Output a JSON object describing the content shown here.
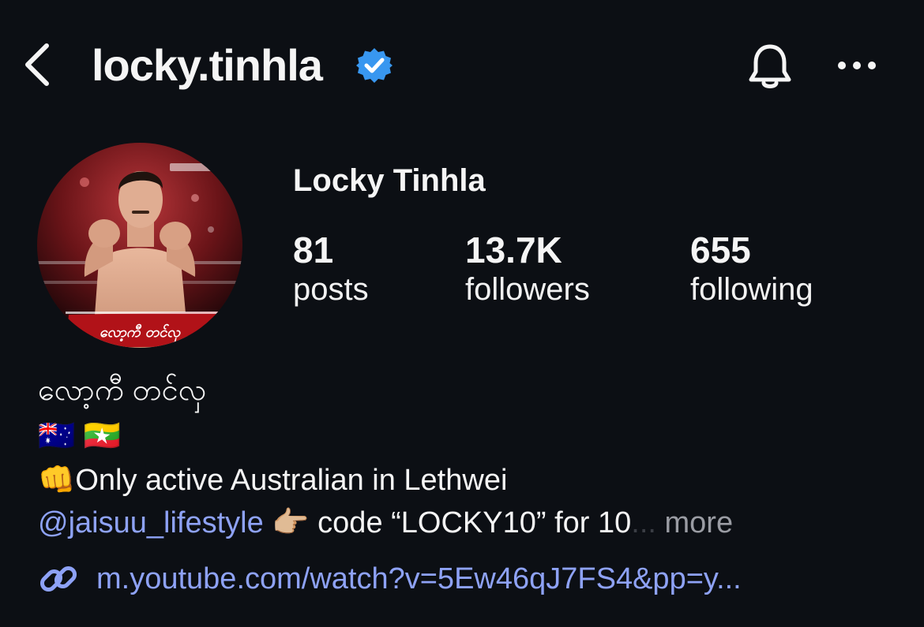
{
  "header": {
    "username": "locky.tinhla",
    "icons": {
      "back": "chevron-left-icon",
      "verified": "verified-badge-icon",
      "notifications": "bell-icon",
      "more": "ellipsis-icon"
    }
  },
  "profile": {
    "display_name": "Locky Tinhla",
    "avatar_banner_text": "လော့ကီ တင်လှ",
    "stats": [
      {
        "value": "81",
        "label": "posts"
      },
      {
        "value": "13.7K",
        "label": "followers"
      },
      {
        "value": "655",
        "label": "following"
      }
    ]
  },
  "bio": {
    "line1": "လော့ကီ တင်လှ",
    "line2_flags": "🇦🇺 🇲🇲",
    "line3_emoji": "👊",
    "line3_text": "Only active Australian in Lethwei",
    "line4_mention": "@jaisuu_lifestyle",
    "line4_emoji": "👉🏼",
    "line4_text": "code “LOCKY10” for 10",
    "line4_fade": "...",
    "more_label": "more",
    "link_icon": "link-icon",
    "link_text": "m.youtube.com/watch?v=5Ew46qJ7FS4&pp=y..."
  },
  "colors": {
    "background": "#0c0f14",
    "text": "#f5f5f5",
    "link": "#8ea2f6",
    "verified": "#3897f0",
    "muted": "#9a9ca3"
  }
}
